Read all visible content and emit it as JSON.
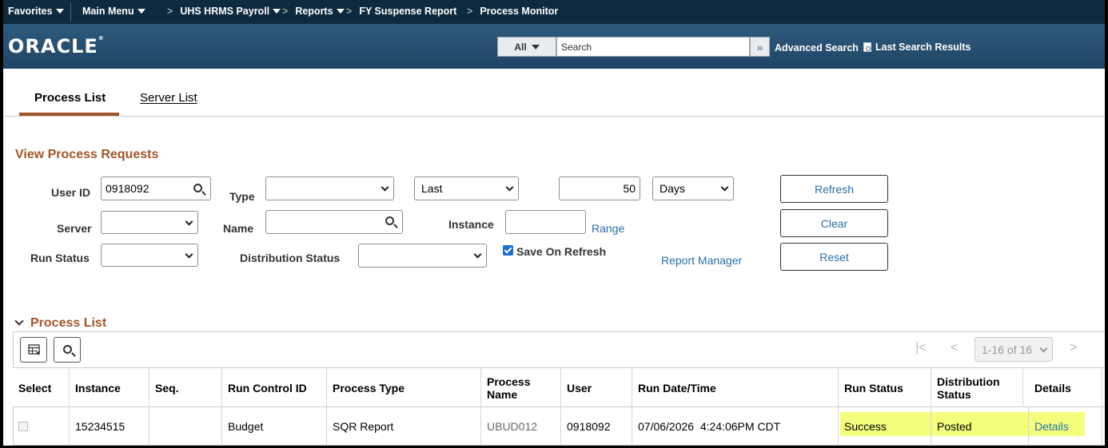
{
  "nav": {
    "favorites": "Favorites",
    "main_menu": "Main Menu",
    "breadcrumbs": [
      "UHS HRMS Payroll",
      "Reports",
      "FY Suspense Report",
      "Process Monitor"
    ],
    "separator": ">"
  },
  "brand": {
    "logo": "ORACLE",
    "search_category": "All",
    "search_placeholder": "Search",
    "search_go": "»",
    "advanced_search": "Advanced Search",
    "last_search_results": "Last Search Results"
  },
  "tabs": [
    {
      "label": "Process List",
      "active": true
    },
    {
      "label": "Server List",
      "active": false
    }
  ],
  "view_requests": {
    "title": "View Process Requests",
    "user_id_label": "User ID",
    "user_id_value": "0918092",
    "type_label": "Type",
    "type_value": "",
    "last_value": "Last",
    "period_value": "50",
    "period_unit": "Days",
    "server_label": "Server",
    "server_value": "",
    "name_label": "Name",
    "name_value": "",
    "instance_label": "Instance",
    "instance_value": "",
    "range_link": "Range",
    "run_status_label": "Run Status",
    "run_status_value": "",
    "dist_status_label": "Distribution Status",
    "dist_status_value": "",
    "save_on_refresh_label": "Save On Refresh",
    "save_on_refresh_checked": true,
    "report_manager_link": "Report Manager",
    "refresh_button": "Refresh",
    "clear_button": "Clear",
    "reset_button": "Reset"
  },
  "process_list": {
    "title": "Process List",
    "pager_text": "1-16 of 16",
    "pager_first": "|<",
    "pager_prev": "<",
    "pager_next": ">",
    "columns": [
      "Select",
      "Instance",
      "Seq.",
      "Run Control ID",
      "Process Type",
      "Process Name",
      "User",
      "Run Date/Time",
      "Run Status",
      "Distribution Status",
      "Details"
    ],
    "rows": [
      {
        "select": false,
        "instance": "15234515",
        "seq": "",
        "run_control_id": "Budget",
        "process_type": "SQR Report",
        "process_name": "UBUD012",
        "user": "0918092",
        "run_datetime": "07/06/2026  4:24:06PM CDT",
        "run_status": "Success",
        "distribution_status": "Posted",
        "details": "Details"
      }
    ]
  },
  "colors": {
    "nav_bg": "#0e2a3f",
    "brand_bg": "#2a5273",
    "accent": "#a3552a",
    "link": "#2b6ea8",
    "highlight": "#f3ff7d"
  }
}
